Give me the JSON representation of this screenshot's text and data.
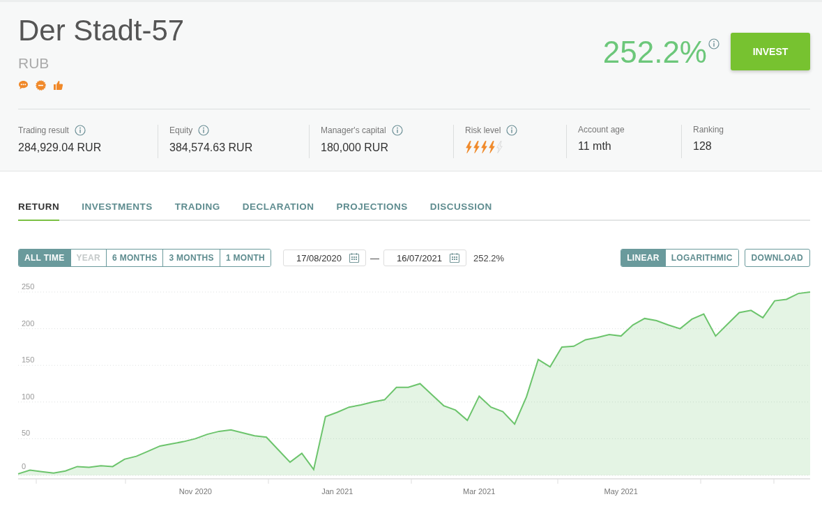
{
  "header": {
    "title": "Der Stadt-57",
    "currency": "RUB",
    "return": "252.2%",
    "invest_button": "INVEST"
  },
  "stats": [
    {
      "label": "Trading result",
      "info": true,
      "value": "284,929.04 RUR",
      "kind": "text"
    },
    {
      "label": "Equity",
      "info": true,
      "value": "384,574.63 RUR",
      "kind": "text"
    },
    {
      "label": "Manager's capital",
      "info": true,
      "value": "180,000 RUR",
      "kind": "text"
    },
    {
      "label": "Risk level",
      "info": true,
      "stars": 4,
      "kind": "rating"
    },
    {
      "label": "Account age",
      "info": false,
      "value": "11 mth",
      "kind": "text"
    },
    {
      "label": "Ranking",
      "info": false,
      "value": "128",
      "kind": "text"
    }
  ],
  "tabs": [
    {
      "label": "RETURN",
      "selected": true
    },
    {
      "label": "INVESTMENTS",
      "selected": false
    },
    {
      "label": "TRADING",
      "selected": false
    },
    {
      "label": "DECLARATION",
      "selected": false
    },
    {
      "label": "PROJECTIONS",
      "selected": false
    },
    {
      "label": "DISCUSSION",
      "selected": false
    }
  ],
  "periods": [
    {
      "label": "ALL TIME",
      "selected": true,
      "disabled": false
    },
    {
      "label": "YEAR",
      "selected": false,
      "disabled": true
    },
    {
      "label": "6 MONTHS",
      "selected": false,
      "disabled": false
    },
    {
      "label": "3 MONTHS",
      "selected": false,
      "disabled": false
    },
    {
      "label": "1 MONTH",
      "selected": false,
      "disabled": false
    }
  ],
  "date_from": "17/08/2020",
  "date_separator": "—",
  "date_to": "16/07/2021",
  "period_return": "252.2%",
  "scales": [
    {
      "label": "LINEAR",
      "selected": true
    },
    {
      "label": "LOGARITHMIC",
      "selected": false
    }
  ],
  "download_button": "DOWNLOAD",
  "chart_data": {
    "type": "area",
    "categories": [
      null,
      null,
      null,
      null,
      null,
      null,
      null,
      null,
      null,
      null,
      null,
      null,
      null,
      null,
      null,
      "Nov 2020",
      null,
      null,
      null,
      null,
      null,
      null,
      null,
      null,
      null,
      null,
      null,
      "Jan 2021",
      null,
      null,
      null,
      null,
      null,
      null,
      null,
      null,
      null,
      null,
      null,
      "Mar 2021",
      null,
      null,
      null,
      null,
      null,
      null,
      null,
      null,
      null,
      null,
      null,
      "May 2021",
      null,
      null,
      null,
      null,
      null,
      null,
      null,
      null,
      null,
      null,
      null,
      null,
      null,
      null,
      null,
      null
    ],
    "series": [
      {
        "color": "#6cc46c",
        "values": [
          2,
          7,
          5,
          3,
          6,
          12,
          11,
          13,
          12,
          22,
          26,
          33,
          40,
          43,
          46,
          50,
          56,
          60,
          62,
          58,
          54,
          52,
          35,
          18,
          30,
          8,
          80,
          86,
          93,
          96,
          100,
          103,
          120,
          120,
          125,
          110,
          95,
          89,
          75,
          108,
          93,
          87,
          70,
          107,
          158,
          148,
          175,
          176,
          185,
          188,
          192,
          190,
          205,
          214,
          211,
          205,
          200,
          213,
          220,
          190,
          206,
          222,
          225,
          215,
          238,
          240,
          248,
          250
        ]
      }
    ],
    "ylim": [
      0,
      250
    ],
    "grid": true,
    "yticks": [
      0,
      50,
      100,
      150,
      200,
      250
    ]
  }
}
